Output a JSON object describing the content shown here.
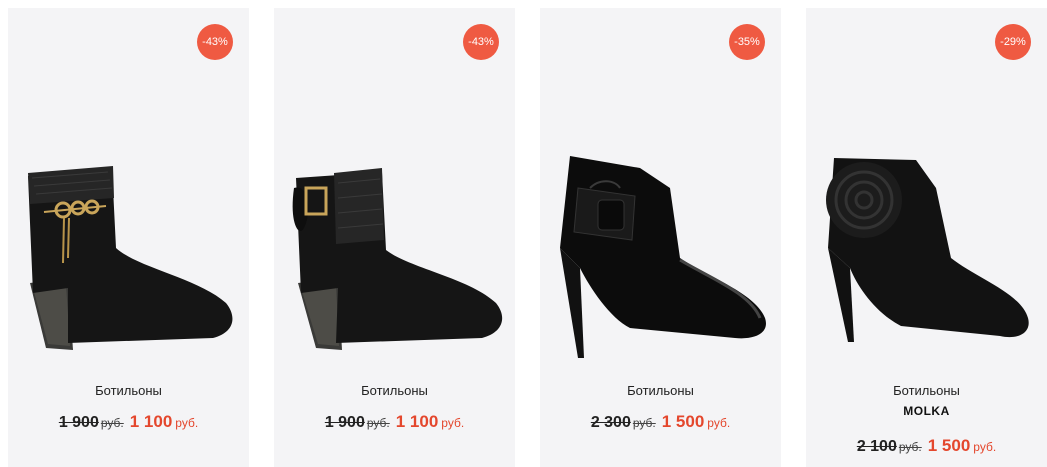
{
  "products": [
    {
      "badge": "-43%",
      "name": "Ботильоны",
      "brand": "",
      "old_price": "1 900",
      "old_currency": "руб.",
      "new_price": "1 100",
      "new_currency": "руб."
    },
    {
      "badge": "-43%",
      "name": "Ботильоны",
      "brand": "",
      "old_price": "1 900",
      "old_currency": "руб.",
      "new_price": "1 100",
      "new_currency": "руб."
    },
    {
      "badge": "-35%",
      "name": "Ботильоны",
      "brand": "",
      "old_price": "2 300",
      "old_currency": "руб.",
      "new_price": "1 500",
      "new_currency": "руб."
    },
    {
      "badge": "-29%",
      "name": "Ботильоны",
      "brand": "MOLKA",
      "old_price": "2 100",
      "old_currency": "руб.",
      "new_price": "1 500",
      "new_currency": "руб."
    }
  ],
  "colors": {
    "card_bg": "#f4f4f6",
    "badge_bg": "#ef5a42",
    "sale_price": "#e4472d"
  }
}
